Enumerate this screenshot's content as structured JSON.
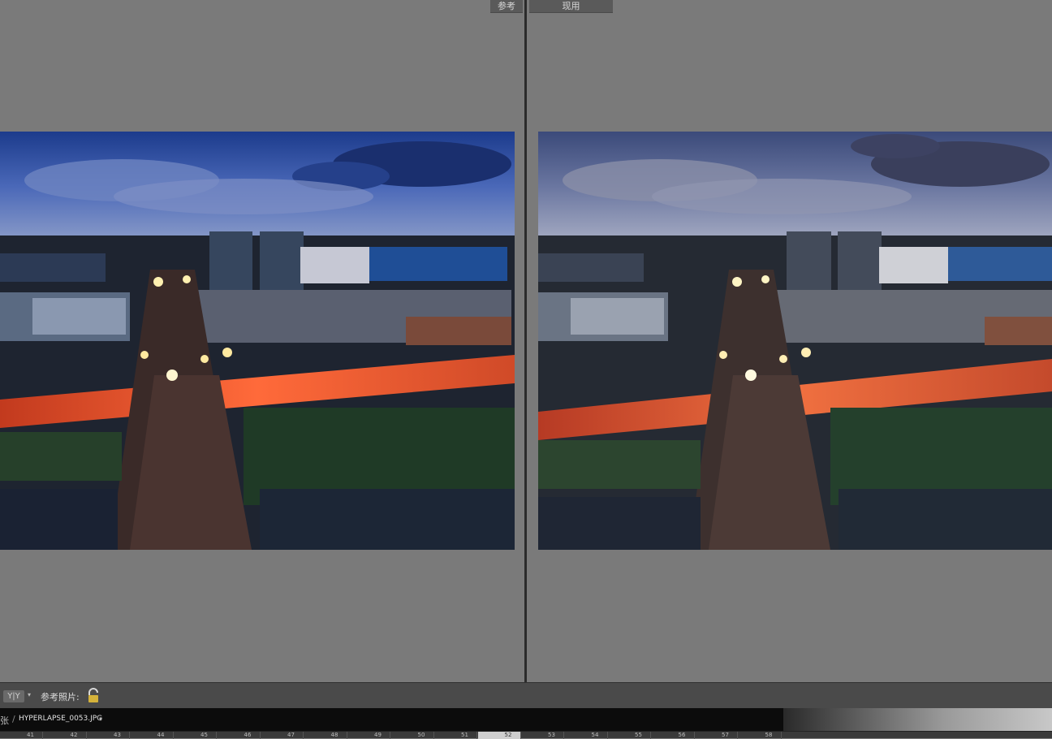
{
  "compare_view": {
    "reference_label": "参考",
    "current_label": "现用"
  },
  "toolbar": {
    "view_mode_label": "Y|Y",
    "reference_photo_label": "参考照片:"
  },
  "filmstrip": {
    "count_fragment": "张",
    "separator": "/",
    "filename": "HYPERLAPSE_0053.JPG",
    "frames": [
      "41",
      "42",
      "43",
      "44",
      "45",
      "46",
      "47",
      "48",
      "49",
      "50",
      "51",
      "52",
      "53",
      "54",
      "55",
      "56",
      "57",
      "58"
    ],
    "selected_frame": "52"
  },
  "colors": {
    "background": "#7a7a7a",
    "toolbar": "#4a4a4a",
    "filmstrip": "#0c0c0c",
    "highlight": "#cfcfcf"
  },
  "icons": [
    "lock-icon",
    "chevron-down-icon"
  ]
}
